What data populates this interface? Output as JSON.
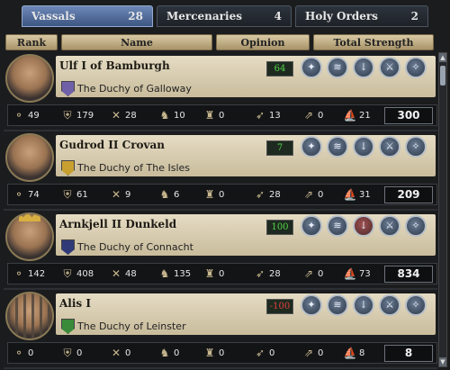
{
  "tabs": [
    {
      "label": "Vassals",
      "count": "28",
      "active": true
    },
    {
      "label": "Mercenaries",
      "count": "4",
      "active": false
    },
    {
      "label": "Holy Orders",
      "count": "2",
      "active": false
    }
  ],
  "headers": {
    "rank": "Rank",
    "name": "Name",
    "opinion": "Opinion",
    "total": "Total Strength"
  },
  "vassals": [
    {
      "name": "Ulf I of Bamburgh",
      "title": "The Duchy of Galloway",
      "opinion": "64",
      "stats": [
        "49",
        "179",
        "28",
        "10",
        "0",
        "13",
        "0",
        "21"
      ],
      "total": "300",
      "shield_color": "#7060a8"
    },
    {
      "name": "Gudrod II Crovan",
      "title": "The Duchy of The Isles",
      "opinion": "7",
      "stats": [
        "74",
        "61",
        "9",
        "6",
        "0",
        "28",
        "0",
        "31"
      ],
      "total": "209",
      "shield_color": "#c8a030"
    },
    {
      "name": "Arnkjell II Dunkeld",
      "title": "The Duchy of Connacht",
      "opinion": "100",
      "stats": [
        "142",
        "408",
        "48",
        "135",
        "0",
        "28",
        "0",
        "73"
      ],
      "total": "834",
      "shield_color": "#303a78"
    },
    {
      "name": "Alis I",
      "title": "The Duchy of Leinster",
      "opinion": "-100",
      "stats": [
        "0",
        "0",
        "0",
        "0",
        "0",
        "0",
        "0",
        "8"
      ],
      "total": "8",
      "shield_color": "#3a8a3a"
    }
  ],
  "stat_icons": [
    "light-foot-icon",
    "heavy-infantry-icon",
    "pikemen-icon",
    "light-cavalry-icon",
    "knights-icon",
    "archers-icon",
    "horse-archers-icon",
    "ships-icon"
  ],
  "action_buttons": [
    "grant-title-icon",
    "revoke-title-icon",
    "imprison-icon",
    "declare-war-icon",
    "dismiss-icon"
  ]
}
